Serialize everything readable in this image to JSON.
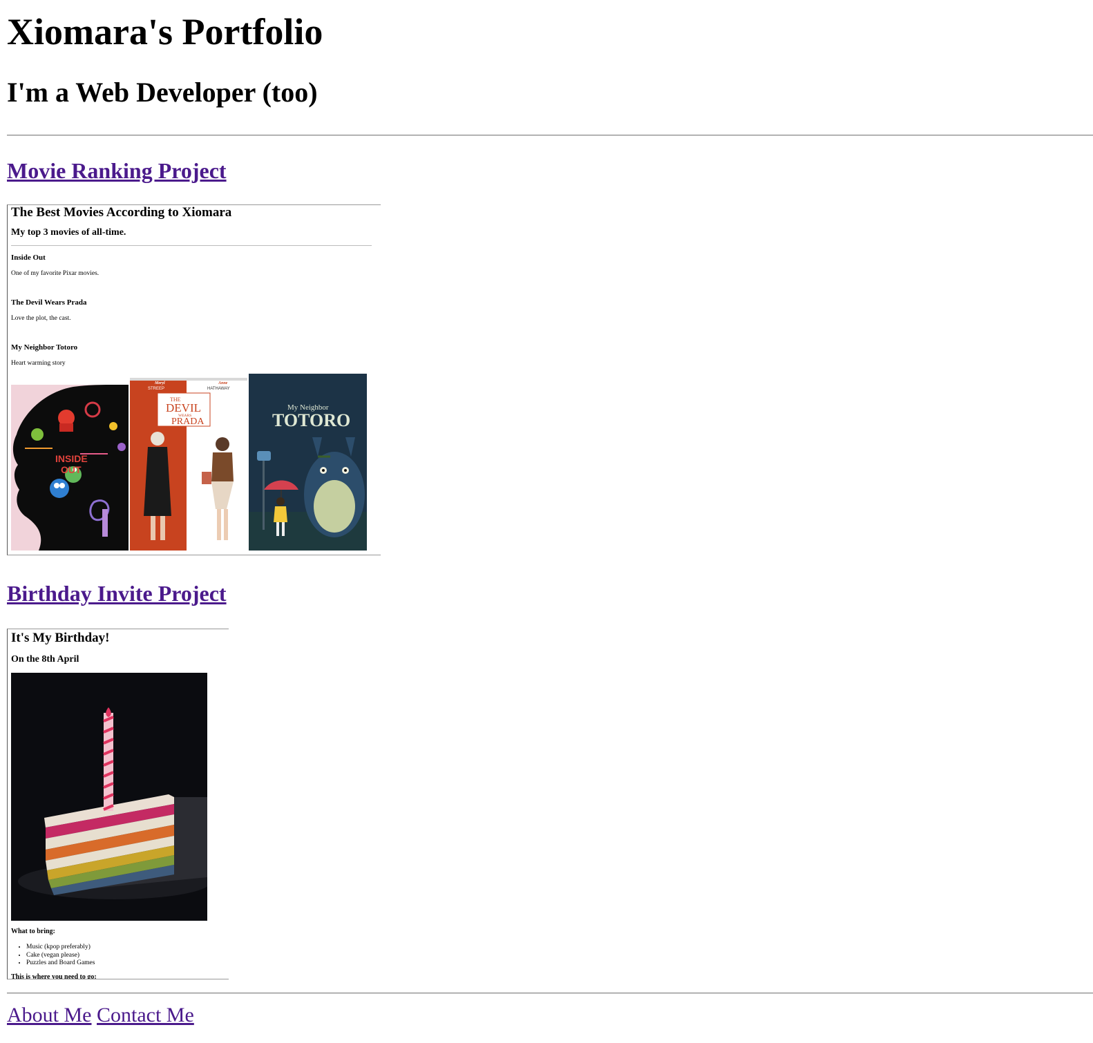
{
  "header": {
    "title": "Xiomara's Portfolio",
    "subtitle": "I'm a Web Developer (too)"
  },
  "projects": [
    {
      "link": "Movie Ranking Project",
      "preview": {
        "title": "The Best Movies According to Xiomara",
        "subtitle": "My top 3 movies of all-time.",
        "movies": [
          {
            "name": "Inside Out",
            "note": "One of my favorite Pixar movies."
          },
          {
            "name": "The Devil Wears Prada",
            "note": "Love the plot, the cast."
          },
          {
            "name": "My Neighbor Totoro",
            "note": "Heart warming story"
          }
        ],
        "posters": {
          "inside_out": {
            "title_line1": "INSIDE",
            "title_line2": "OUT"
          },
          "devil_wears_prada": {
            "actor_left_first": "Meryl",
            "actor_left_last": "STREEP",
            "actor_right_first": "Anne",
            "actor_right_last": "HATHAWAY",
            "title_the": "THE",
            "title_devil": "DEVIL",
            "title_wears": "WEARS",
            "title_prada": "PRADA"
          },
          "totoro": {
            "title_small": "My Neighbor",
            "title_big": "TOTORO"
          }
        }
      }
    },
    {
      "link": "Birthday Invite Project",
      "preview": {
        "title": "It's My Birthday!",
        "subtitle": "On the 8th April",
        "bring_heading": "What to bring:",
        "bring_items": [
          "Music (kpop preferably)",
          "Cake (vegan please)",
          "Puzzles and Board Games"
        ],
        "directions_heading": "This is where you need to go:"
      }
    }
  ],
  "footer": {
    "about": "About Me",
    "contact": "Contact Me"
  },
  "colors": {
    "link": "#4b1a8c",
    "inside_out_bg": "#f1d3da",
    "prada_red": "#c8431f",
    "totoro_bg": "#1c3346"
  }
}
